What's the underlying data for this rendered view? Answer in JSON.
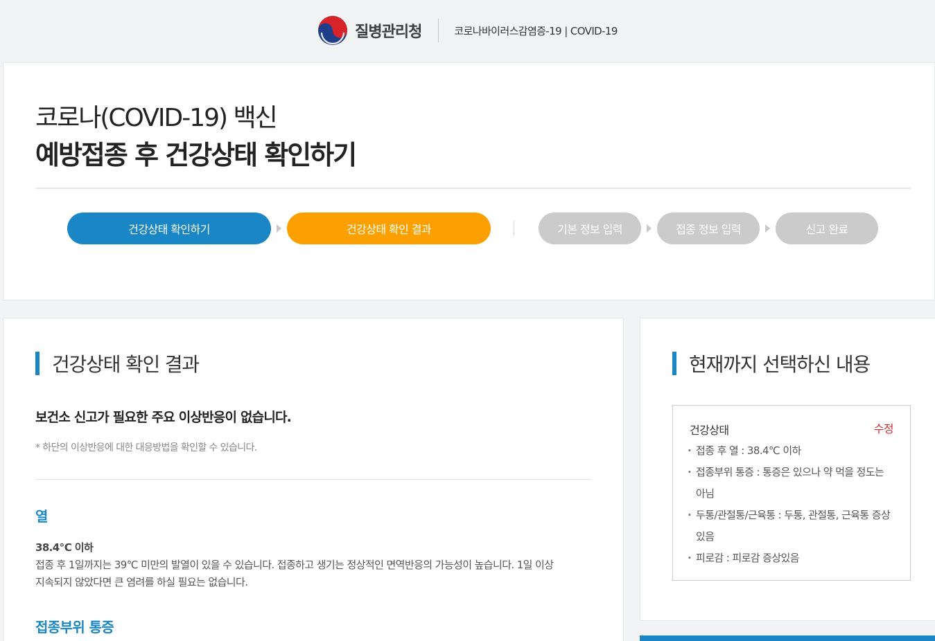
{
  "header": {
    "agency_name": "질병관리청",
    "site_name": "코로나바이러스감염증-19 | COVID-19"
  },
  "title": {
    "line1": "코로나(COVID-19) 백신",
    "line2": "예방접종 후 건강상태 확인하기"
  },
  "steps": [
    {
      "label": "건강상태 확인하기",
      "state": "done",
      "color": "#1a86c6"
    },
    {
      "label": "건강상태 확인 결과",
      "state": "current",
      "color": "#fba000"
    },
    {
      "label": "기본 정보 입력",
      "state": "pending",
      "color": "#cbcbcb"
    },
    {
      "label": "접종 정보 입력",
      "state": "pending",
      "color": "#cbcbcb"
    },
    {
      "label": "신고 완료",
      "state": "pending",
      "color": "#cbcbcb"
    }
  ],
  "result": {
    "heading": "건강상태 확인 결과",
    "main_message": "보건소 신고가 필요한 주요 이상반응이 없습니다.",
    "note": "* 하단의 이상반응에 대한 대응방법을 확인할 수 있습니다.",
    "sections": [
      {
        "title": "열",
        "item_title": "38.4℃ 이하",
        "description": "접종 후 1일까지는 39℃ 미만의 발열이 있을 수 있습니다. 접종하고 생기는 정상적인 면역반응의 가능성이 높습니다. 1일 이상 지속되지 않았다면 큰 염려를 하실 필요는 없습니다."
      },
      {
        "title": "접종부위 통증"
      }
    ]
  },
  "summary": {
    "heading": "현재까지 선택하신 내용",
    "box_title": "건강상태",
    "edit_label": "수정",
    "items": [
      "접종 후 열 : 38.4℃ 이하",
      "접종부위 통증 : 통증은 있으나 약 먹을 정도는 아님",
      "두통/관절통/근육통 : 두통, 관절통, 근육통 증상있음",
      "피로감 : 피로감 증상있음"
    ]
  },
  "colors": {
    "primary": "#1a86c6",
    "current_step": "#fba000",
    "pending_step": "#cbcbcb",
    "edit": "#d32f2f"
  }
}
